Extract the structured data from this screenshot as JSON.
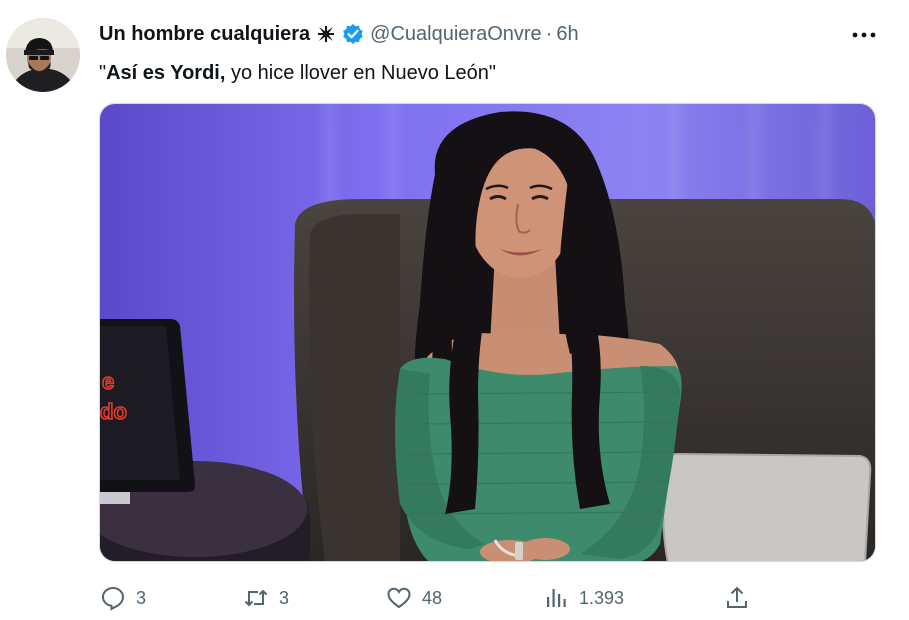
{
  "tweet": {
    "display_name": "Un hombre cualquiera",
    "handle": "@CualquieraOnvre",
    "separator": "·",
    "time": "6h",
    "text_bold": "Así es Yordi,",
    "text_rest": " yo hice llover en Nuevo León\"",
    "text_open_quote": "\"",
    "media_sign_text_1": "e",
    "media_sign_text_2": "do"
  },
  "actions": {
    "replies": "3",
    "retweets": "3",
    "likes": "48",
    "views": "1.393"
  },
  "colors": {
    "text_primary": "#0f1419",
    "text_secondary": "#536471",
    "verified_blue": "#1d9bf0",
    "border": "#cfd9de"
  },
  "icons": {
    "cross": "maltese-cross-icon",
    "verified": "verified-badge-icon",
    "more": "more-dots-icon",
    "reply": "reply-icon",
    "retweet": "retweet-icon",
    "like": "heart-icon",
    "views": "views-bar-chart-icon",
    "share": "share-upload-icon"
  }
}
